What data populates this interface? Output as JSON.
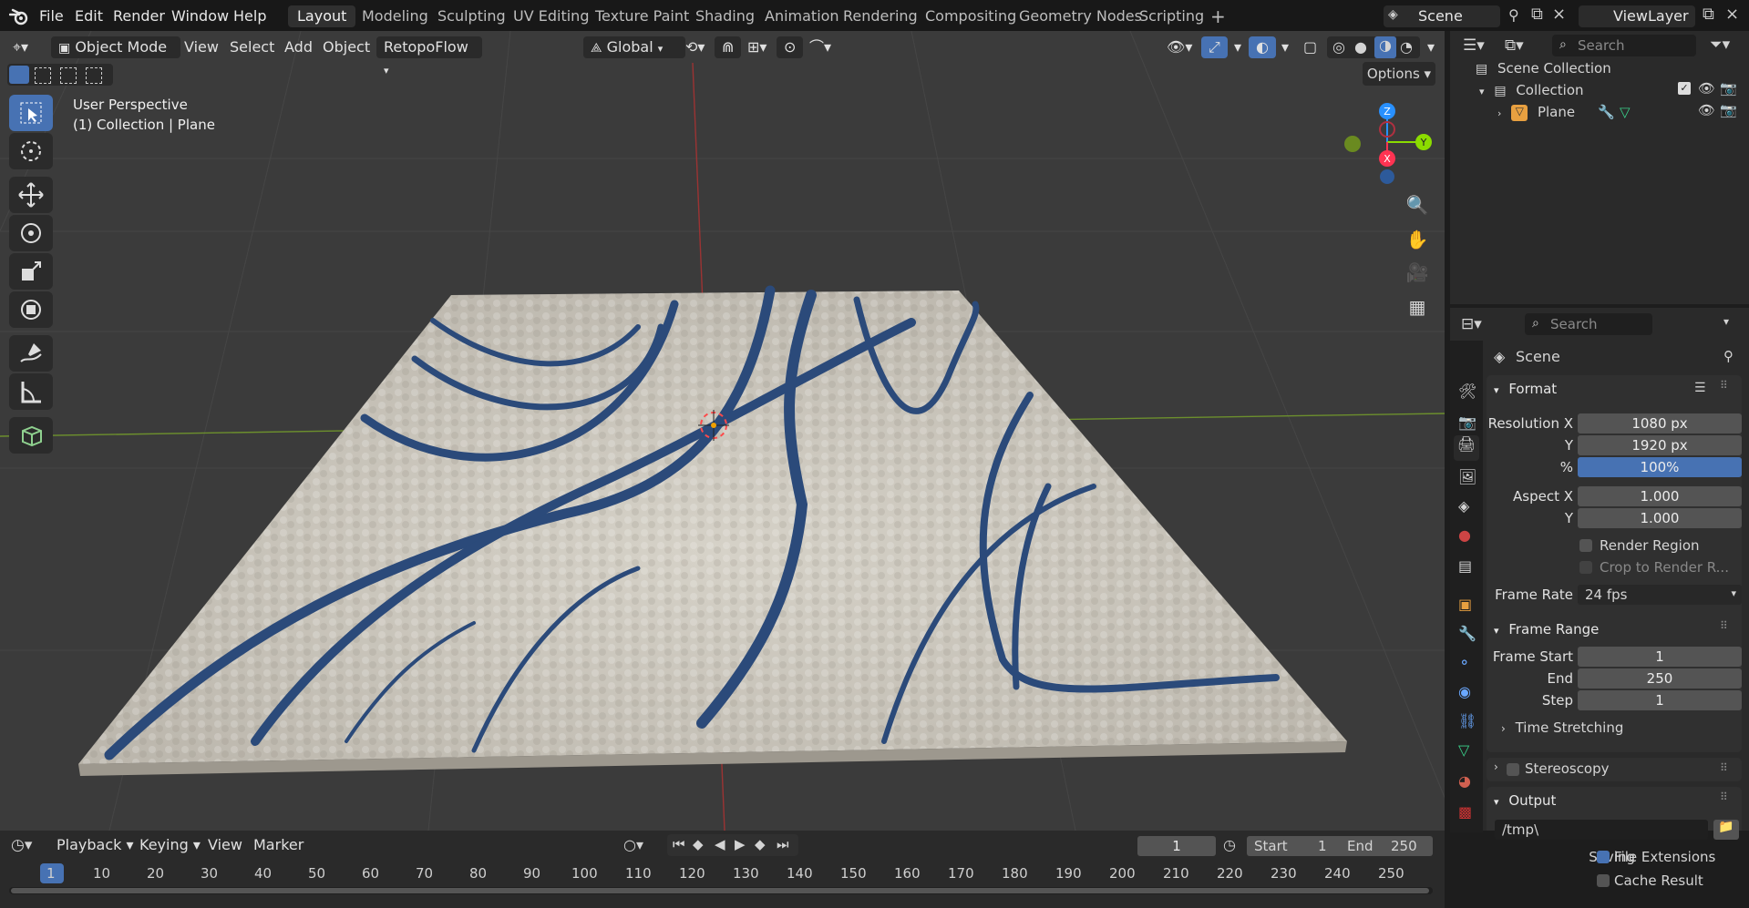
{
  "menu": {
    "file": "File",
    "edit": "Edit",
    "render": "Render",
    "window": "Window",
    "help": "Help"
  },
  "workspaces": [
    "Layout",
    "Modeling",
    "Sculpting",
    "UV Editing",
    "Texture Paint",
    "Shading",
    "Animation",
    "Rendering",
    "Compositing",
    "Geometry Nodes",
    "Scripting"
  ],
  "scene_field": "Scene",
  "viewlayer_field": "ViewLayer",
  "viewport_header": {
    "mode": "Object Mode",
    "view": "View",
    "select": "Select",
    "add": "Add",
    "object": "Object",
    "addon": "RetopoFlow",
    "orientation": "Global",
    "options": "Options"
  },
  "overlay_text": {
    "perspective": "User Perspective",
    "context": "(1) Collection | Plane"
  },
  "gizmo": {
    "z": "Z",
    "y": "Y",
    "x": "X"
  },
  "outliner": {
    "search_placeholder": "Search",
    "scene_collection": "Scene Collection",
    "collection": "Collection",
    "object": "Plane"
  },
  "properties": {
    "search_placeholder": "Search",
    "context": "Scene",
    "format": {
      "title": "Format",
      "res_x_label": "Resolution X",
      "res_x": "1080 px",
      "res_y_label": "Y",
      "res_y": "1920 px",
      "pct_label": "%",
      "pct": "100%",
      "aspect_x_label": "Aspect X",
      "aspect_x": "1.000",
      "aspect_y_label": "Y",
      "aspect_y": "1.000",
      "render_region": "Render Region",
      "crop": "Crop to Render R...",
      "frame_rate_label": "Frame Rate",
      "frame_rate": "24 fps"
    },
    "frame_range": {
      "title": "Frame Range",
      "start_label": "Frame Start",
      "start": "1",
      "end_label": "End",
      "end": "250",
      "step_label": "Step",
      "step": "1"
    },
    "time_stretching": "Time Stretching",
    "stereoscopy": "Stereoscopy",
    "output": {
      "title": "Output",
      "path": "/tmp\\",
      "saving_label": "Saving",
      "file_ext": "File Extensions",
      "cache": "Cache Result"
    }
  },
  "timeline": {
    "playback": "Playback",
    "keying": "Keying",
    "view": "View",
    "marker": "Marker",
    "current": "1",
    "start_label": "Start",
    "start": "1",
    "end_label": "End",
    "end": "250",
    "ticks": [
      "1",
      "10",
      "20",
      "30",
      "40",
      "50",
      "60",
      "70",
      "80",
      "90",
      "100",
      "110",
      "120",
      "130",
      "140",
      "150",
      "160",
      "170",
      "180",
      "190",
      "200",
      "210",
      "220",
      "230",
      "240",
      "250"
    ]
  },
  "colors": {
    "accent": "#4772b3",
    "x_axis": "#ff3352",
    "y_axis": "#8bdc00",
    "z_axis": "#2890ff",
    "rug_blue": "#2b4a7a"
  }
}
